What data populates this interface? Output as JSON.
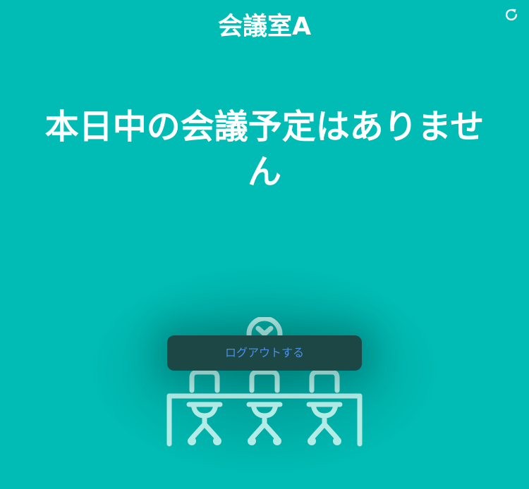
{
  "header": {
    "room_name": "会議室A",
    "refresh_icon": "refresh-icon"
  },
  "main": {
    "message": "本日中の会議予定はありません"
  },
  "illustration": {
    "icon": "meeting-room-illustration"
  },
  "dialog": {
    "logout_label": "ログアウトする"
  },
  "colors": {
    "background": "#00bcb4",
    "text": "#ffffff",
    "button_bg": "#1d4745",
    "button_text": "#4a90e2",
    "illustration": "#b3ebe6"
  }
}
